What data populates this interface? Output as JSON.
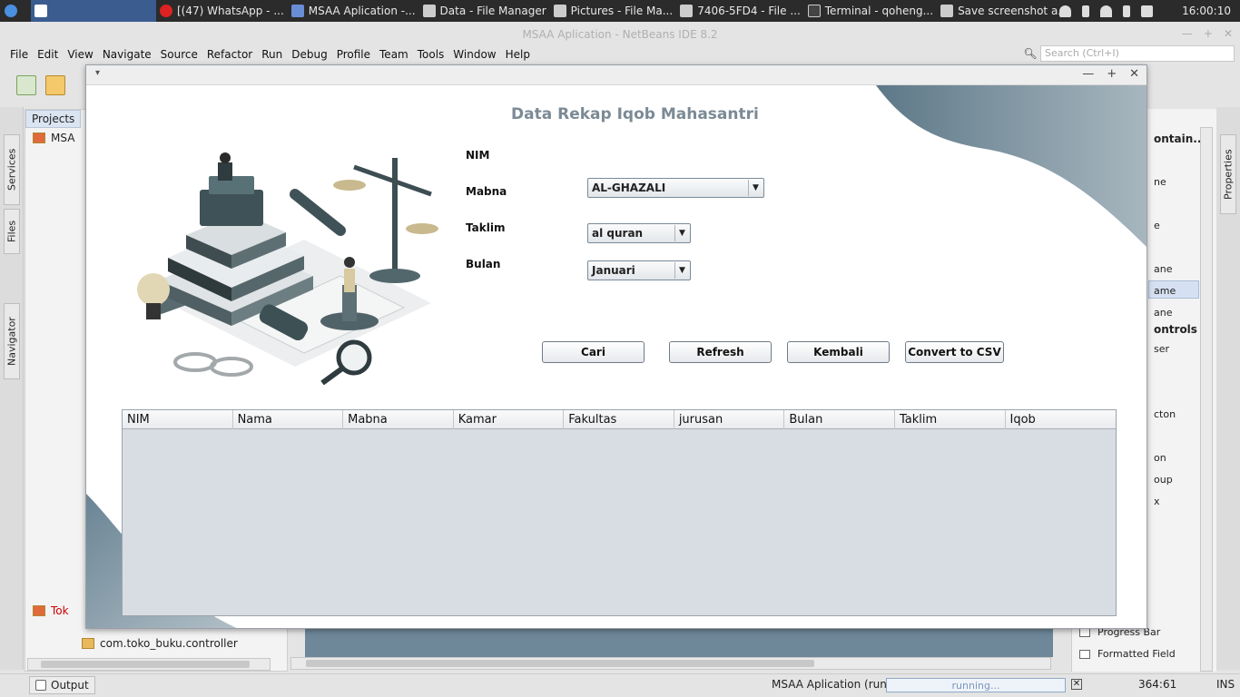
{
  "taskbar": {
    "items": [
      {
        "label": "",
        "color": "#ffffff"
      },
      {
        "label": "[(47) WhatsApp - ...",
        "color": "#d22"
      },
      {
        "label": "MSAA Aplication -...",
        "color": "#6a8ed6"
      },
      {
        "label": "Data - File Manager",
        "color": "#ddd"
      },
      {
        "label": "Pictures - File Ma...",
        "color": "#ddd"
      },
      {
        "label": "7406-5FD4 - File ...",
        "color": "#ddd"
      },
      {
        "label": "Terminal - qoheng...",
        "color": "#ddd"
      },
      {
        "label": "Save screenshot a...",
        "color": "#ddd"
      }
    ],
    "clock": "16:00:10"
  },
  "ide": {
    "title": "MSAA Aplication - NetBeans IDE 8.2",
    "menu": [
      {
        "label": "File"
      },
      {
        "label": "Edit"
      },
      {
        "label": "View"
      },
      {
        "label": "Navigate"
      },
      {
        "label": "Source"
      },
      {
        "label": "Refactor"
      },
      {
        "label": "Run"
      },
      {
        "label": "Debug"
      },
      {
        "label": "Profile"
      },
      {
        "label": "Team"
      },
      {
        "label": "Tools"
      },
      {
        "label": "Window"
      },
      {
        "label": "Help"
      }
    ],
    "search_placeholder": "Search (Ctrl+I)",
    "projects_tab": "Projects",
    "side_tabs": {
      "services": "Services",
      "files": "Files",
      "navigator": "Navigator",
      "properties": "Properties"
    },
    "tree": {
      "msa_root": "MSA",
      "toko_root": "Tok",
      "controller_pkg": "com.toko_buku.controller"
    },
    "palette": {
      "rows": [
        "ontain...",
        "ne",
        "e",
        "ane",
        "ame",
        "ane",
        "ontrols",
        "ser",
        "cton",
        "on",
        "oup",
        "x"
      ],
      "progress_bar": "Progress Bar",
      "formatted_field": "Formatted Field"
    },
    "status": {
      "output_tab": "Output",
      "run_label": "MSAA Aplication (run)",
      "progress_text": "running...",
      "caret": "364:61",
      "mode": "INS"
    }
  },
  "app": {
    "title": "Data Rekap Iqob Mahasantri",
    "labels": {
      "nim": "NIM",
      "mabna": "Mabna",
      "taklim": "Taklim",
      "bulan": "Bulan"
    },
    "mabna_value": "AL-GHAZALI",
    "taklim_value": "al quran",
    "bulan_value": "Januari",
    "buttons": {
      "cari": "Cari",
      "refresh": "Refresh",
      "kembali": "Kembali",
      "csv": "Convert to CSV"
    },
    "table_columns": [
      "NIM",
      "Nama",
      "Mabna",
      "Kamar",
      "Fakultas",
      "jurusan",
      "Bulan",
      "Taklim",
      "Iqob"
    ],
    "colors": {
      "wave": "#8e9ea8",
      "title": "#7b8a95",
      "table_bg": "#d8dce3"
    }
  }
}
